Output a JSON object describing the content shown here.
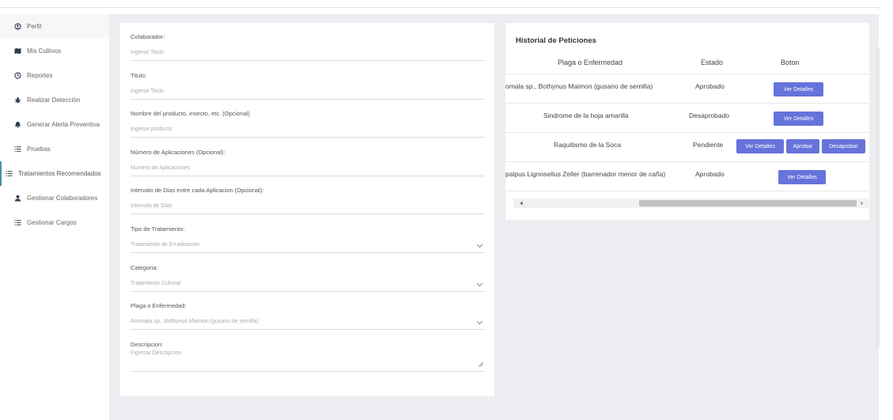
{
  "sidebar": {
    "items": [
      {
        "label": "Perfil",
        "icon": "user-circle-icon"
      },
      {
        "label": "Mis Cultivos",
        "icon": "map-icon"
      },
      {
        "label": "Reportes",
        "icon": "clock-icon"
      },
      {
        "label": "Realizar Detección",
        "icon": "bug-icon"
      },
      {
        "label": "Generar Alerta Preventiva",
        "icon": "bell-icon"
      },
      {
        "label": "Pruebas",
        "icon": "list-icon"
      },
      {
        "label": "Tratamientos Recomendados",
        "icon": "list-icon"
      },
      {
        "label": "Gestionar Colaboradores",
        "icon": "user-icon"
      },
      {
        "label": "Gestionar Cargos",
        "icon": "list-icon"
      }
    ]
  },
  "form": {
    "colaborador": {
      "label": "Colaborador:",
      "placeholder": "Ingrese Titulo"
    },
    "titulo": {
      "label": "Titulo:",
      "placeholder": "Ingrese Titulo"
    },
    "producto": {
      "label": "Nombre del producto, insecto, etc. (Opcional)",
      "placeholder": "Ingrese producto"
    },
    "aplicaciones": {
      "label": "Número de Aplicaciones (Opcional):",
      "placeholder": "Numero de Aplicaciones"
    },
    "intervalo": {
      "label": "Intervalo de Dias entre cada Aplicacion (Opcional):",
      "placeholder": "Intervalo de Dias"
    },
    "tipo": {
      "label": "Tipo de Tratamiento:",
      "selected": "Tratamiento de Erradicacion"
    },
    "categoria": {
      "label": "Categoria:",
      "selected": "Tratamiento Cultural"
    },
    "plaga": {
      "label": "Plaga o Enfermedad:",
      "selected": "Anomala sp., Bothynus Maimon (gusano de semilla)"
    },
    "descripcion": {
      "label": "Descripcion:",
      "placeholder": "Ingresar Descripcion"
    }
  },
  "historial": {
    "title": "Historial de Peticiones",
    "headers": {
      "plaga": "Plaga o Enfermedad",
      "estado": "Estado",
      "boton": "Boton"
    },
    "rows": [
      {
        "plaga": "omala sp., Bothynus Maimon (gusano de semilla)",
        "estado": "Aprobado",
        "buttons": [
          "Ver Detalles"
        ]
      },
      {
        "plaga": "Sindrome de la hoja amarilla",
        "estado": "Desaprobado",
        "buttons": [
          "Ver Detalles"
        ]
      },
      {
        "plaga": "Raquitismo de la Soca",
        "estado": "Pendiente",
        "buttons": [
          "Ver Detalles",
          "Aprobar",
          "Desaprobar"
        ]
      },
      {
        "plaga": "palpus Lignosellus Zeller (barrenador menor de caña)",
        "estado": "Aprobado",
        "buttons": [
          "Ver Detalles"
        ]
      }
    ]
  },
  "colors": {
    "accent_button": "#6673da",
    "main_bg": "#ecedf1",
    "icon": "#2d3e50"
  }
}
